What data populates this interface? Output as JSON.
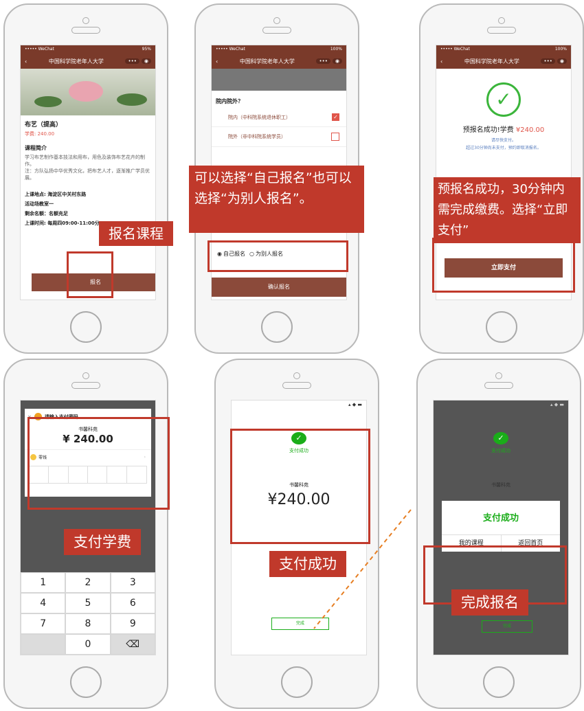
{
  "phone1": {
    "status_left": "••••• WeChat",
    "status_right": "95%",
    "nav_title": "中国科学院老年人大学",
    "course_title": "布艺（提高）",
    "fee": "学费: 240.00",
    "intro_title": "课程简介",
    "intro_text": "学习布艺制作基本技法和用布，用色及装饰布艺花卉的制作。",
    "intro_text2": "注：方队弘扬中华优秀文化，把布艺人才，逐渐推广学员优展。",
    "location": "上课地点: 海淀区中关村东路",
    "classroom": "活动场教室一",
    "remaining": "剩余名额：名额充足",
    "time": "上课时间: 每周四09:00-11:00分",
    "signup_button": "报名",
    "callout": "报名课程"
  },
  "phone2": {
    "status_left": "••••• WeChat",
    "status_right": "100%",
    "nav_title": "中国科学院老年人大学",
    "question": "院内院外？",
    "option_in": "院内（中科院系统退休职工）",
    "option_out": "院外（非中科院系统学员）",
    "radio_self": "自己报名",
    "radio_other": "为别人报名",
    "confirm_button": "确认报名",
    "callout": "可以选择“自己报名”也可以选择“为别人报名”。"
  },
  "phone3": {
    "status_left": "••••• WeChat",
    "status_right": "100%",
    "nav_title": "中国科学院老年人大学",
    "success_title": "预报名成功!学费",
    "success_amount": "¥240.00",
    "note1": "请尽快支付。",
    "note2": "超过30分钟尚未支付，预约即取消报名。",
    "pay_button": "立即支付",
    "callout": "预报名成功，30分钟内需完成缴费。选择“立即支付”"
  },
  "phone4": {
    "dialog_title": "请输入支付密码",
    "merchant": "书馨科苑",
    "amount": "¥ 240.00",
    "wallet": "零钱",
    "keys": [
      "1",
      "2",
      "3",
      "4",
      "5",
      "6",
      "7",
      "8",
      "9",
      "",
      "0",
      "⌫"
    ],
    "callout": "支付学费"
  },
  "phone5": {
    "success": "支付成功",
    "merchant": "书馨科苑",
    "amount": "¥240.00",
    "done_button": "完成",
    "callout": "支付成功"
  },
  "phone6": {
    "bg_success": "支付成功",
    "bg_merchant": "书馨科苑",
    "dialog_title": "支付成功",
    "my_courses": "我的课程",
    "back_home": "返回首页",
    "done_button": "完成",
    "callout": "完成报名"
  },
  "colors": {
    "brand_brown": "#8b4a3a",
    "callout_red": "#c0392b",
    "wechat_green": "#1aad19"
  }
}
